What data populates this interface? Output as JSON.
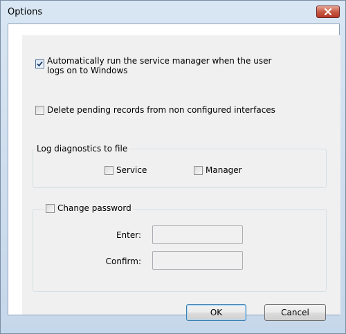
{
  "window": {
    "title": "Options"
  },
  "options": {
    "auto_run": {
      "label_line1": "Automatically run the service manager when the user",
      "label_line2": "logs on to Windows",
      "checked": true
    },
    "delete_pending": {
      "label": "Delete pending records from non configured interfaces",
      "checked": false
    }
  },
  "diagnostics": {
    "legend": "Log diagnostics to file",
    "service_label": "Service",
    "service_checked": false,
    "manager_label": "Manager",
    "manager_checked": false
  },
  "password": {
    "legend": "Change password",
    "checked": false,
    "enter_label": "Enter:",
    "enter_value": "",
    "confirm_label": "Confirm:",
    "confirm_value": ""
  },
  "buttons": {
    "ok": "OK",
    "cancel": "Cancel"
  },
  "icons": {
    "close": "close-icon",
    "check": "checkmark-icon"
  },
  "colors": {
    "close_button": "#c75a45",
    "default_button_border": "#3c7fb1"
  }
}
